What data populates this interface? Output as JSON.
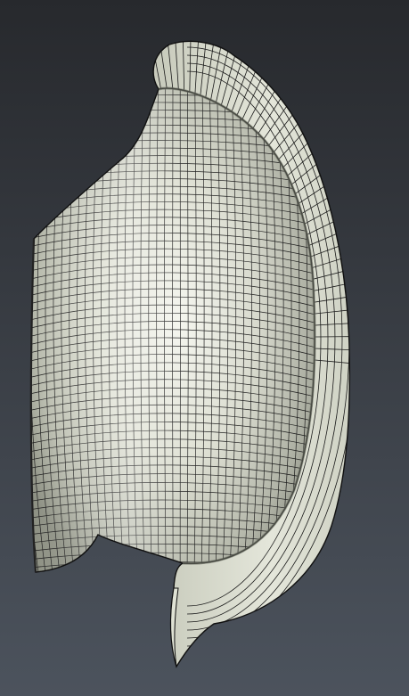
{
  "viewport": {
    "background_top": "#27292d",
    "background_bottom": "#4c535d"
  },
  "model": {
    "kind": "3d-mesh-surface",
    "fill_light": "#f2f3ea",
    "fill_mid": "#d9dccd",
    "fill_dark": "#a9ad9d",
    "grid_color": "#1a1a1a",
    "outline_color": "#111111"
  }
}
